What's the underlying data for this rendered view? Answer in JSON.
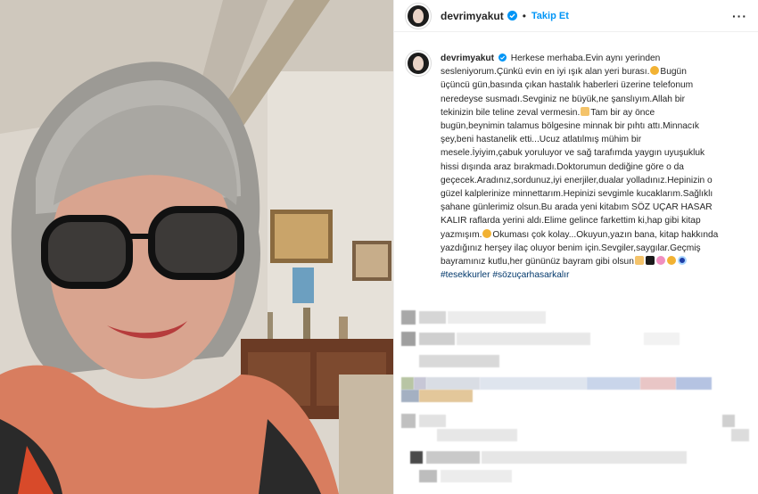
{
  "post": {
    "username": "devrimyakut",
    "follow_label": "Takip Et",
    "separator": "•",
    "more_label": "···"
  },
  "caption": {
    "username": "devrimyakut",
    "line1": "Herkese merhaba.Evin aynı yerinden",
    "line2": "sesleniyorum.Çünkü evin en iyi ışık alan yeri burası.",
    "line2b": "Bugün",
    "line3": "üçüncü gün,basında çıkan hastalık haberleri üzerine telefonum",
    "line4": "neredeyse susmadı.Sevginiz ne büyük,ne şanslıyım.Allah bir",
    "line5": "tekinizin bile teline zeval vermesin.",
    "line5b": "Tam bir ay önce",
    "line6": "bugün,beynimin talamus bölgesine minnak bir pıhtı attı.Minnacık",
    "line7": "şey,beni hastanelik etti...Ucuz atlatılmış mühim bir",
    "line8": "mesele.İyiyim,çabuk yoruluyor ve sağ tarafımda yaygın uyuşukluk",
    "line9": "hissi dışında araz bırakmadı.Doktorumun dediğine göre o da",
    "line10": "geçecek.Aradınız,sordunuz,iyi enerjiler,dualar yolladınız.Hepinizin o",
    "line11": "güzel kalplerinize minnettarım.Hepinizi sevgimle kucaklarım.Sağlıklı",
    "line12": "şahane günlerimiz olsun.Bu arada yeni kitabım SÖZ UÇAR HASAR",
    "line13": "KALIR raflarda yerini aldı.Elime gelince farkettim ki,hap gibi kitap",
    "line14": "yazmışım.",
    "line14b": "Okuması çok kolay...Okuyun,yazın bana, kitap hakkında",
    "line15": "yazdığınız herşey ilaç oluyor benim için.Sevgiler,saygılar.Geçmiş",
    "line16": "bayramınız kutlu,her gününüz bayram gibi olsun",
    "hashtag1": "#tesekkurler",
    "hashtag2": "#sözuçarhasarkalır"
  },
  "icons": {
    "verified": "verified-badge-icon",
    "more": "more-options-icon",
    "emoji_smile": "smile-emoji-icon",
    "emoji_pray": "pray-emoji-icon",
    "emoji_heart": "heart-emoji-icon",
    "emoji_flower": "flower-emoji-icon",
    "emoji_evil_eye": "evil-eye-emoji-icon"
  },
  "colors": {
    "link": "#0095f6",
    "hashtag": "#00376b",
    "text": "#262626",
    "border": "#efefef"
  }
}
